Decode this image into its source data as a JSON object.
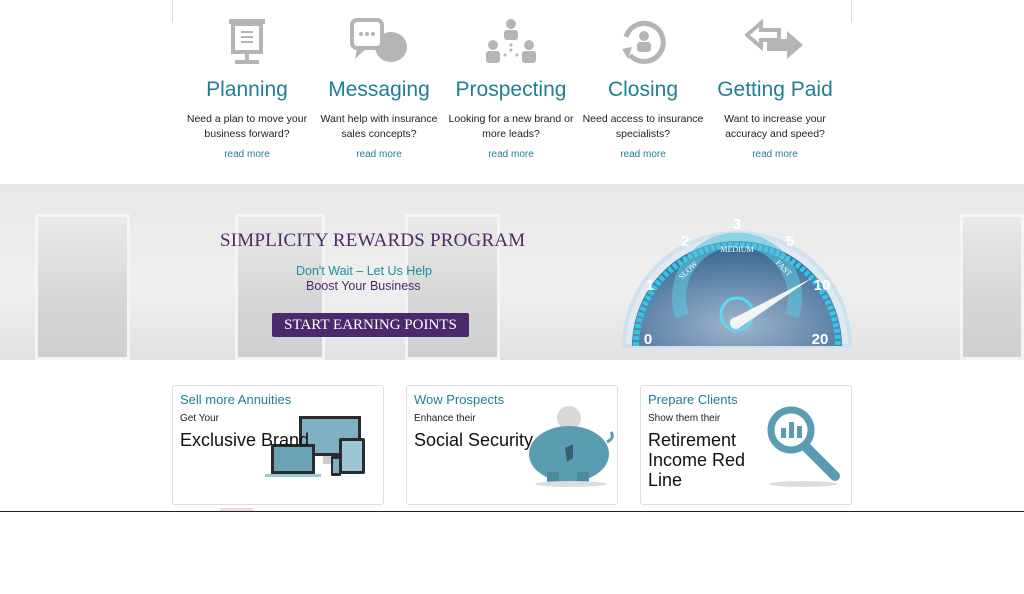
{
  "features": [
    {
      "icon": "presentation-board-icon",
      "title": "Planning",
      "desc": "Need a plan to move your business forward?",
      "link": "read more"
    },
    {
      "icon": "chat-bubbles-icon",
      "title": "Messaging",
      "desc": "Want help with insurance sales concepts?",
      "link": "read more"
    },
    {
      "icon": "people-network-icon",
      "title": "Prospecting",
      "desc": "Looking for a new brand or more leads?",
      "link": "read more"
    },
    {
      "icon": "person-cycle-icon",
      "title": "Closing",
      "desc": "Need access to insurance specialists?",
      "link": "read more"
    },
    {
      "icon": "exchange-arrows-icon",
      "title": "Getting Paid",
      "desc": "Want to increase your accuracy and speed?",
      "link": "read more"
    }
  ],
  "banner": {
    "title": "SIMPLICITY REWARDS PROGRAM",
    "tagline1": "Don't Wait – Let Us Help",
    "tagline2a": "Boost",
    "tagline2b": " Your Business",
    "cta": "START EARNING POINTS",
    "gauge": {
      "ticks": [
        "0",
        "1",
        "2",
        "3",
        "5",
        "10",
        "20"
      ],
      "zones": [
        "SLOW",
        "MEDIUM",
        "FAST"
      ],
      "needle_value": "10",
      "accent": "#2ec8e8"
    }
  },
  "cards": [
    {
      "title": "Sell more Annuities",
      "sub": "Get Your",
      "big": "Exclusive Brand",
      "icon": "devices-icon"
    },
    {
      "title": "Wow Prospects",
      "sub": "Enhance their",
      "big": "Social Security",
      "icon": "piggy-bank-icon"
    },
    {
      "title": "Prepare Clients",
      "sub": "Show them their",
      "big": "Retirement Income Red Line",
      "icon": "magnifier-chart-icon"
    }
  ],
  "colors": {
    "teal": "#1f7f94",
    "purple": "#4b2a6b",
    "icon_gray": "#b5b5b5"
  }
}
